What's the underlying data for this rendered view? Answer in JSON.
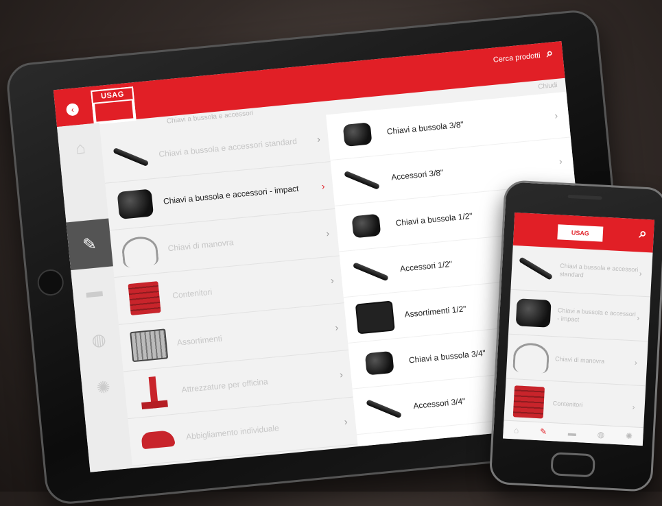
{
  "tablet": {
    "header": {
      "logo_text": "USAG",
      "search_label": "Cerca prodotti",
      "search_icon": "search-icon",
      "back_icon": "back-icon"
    },
    "breadcrumb": "Chiavi a bussola e accessori",
    "close_label": "Chiudi",
    "rail": [
      {
        "icon": "home-icon"
      },
      {
        "icon": "wrench-icon",
        "active": true
      },
      {
        "icon": "car-icon"
      },
      {
        "icon": "globe-icon"
      },
      {
        "icon": "settings-icon"
      }
    ],
    "categories": [
      {
        "label": "Chiavi a bussola e accessori standard",
        "image": "ratchet-image"
      },
      {
        "label": "Chiavi a bussola e accessori - impact",
        "image": "impact-socket-image",
        "selected": true
      },
      {
        "label": "Chiavi di manovra",
        "image": "pliers-image"
      },
      {
        "label": "Contenitori",
        "image": "tool-cabinet-image"
      },
      {
        "label": "Assortimenti",
        "image": "tool-case-image"
      },
      {
        "label": "Attrezzature per officina",
        "image": "jack-image"
      },
      {
        "label": "Abbigliamento individuale",
        "image": "safety-shoe-image"
      }
    ],
    "subcategories": [
      {
        "label": "Chiavi a bussola 3/8\"",
        "image": "socket-image"
      },
      {
        "label": "Accessori 3/8\"",
        "image": "extension-bar-image"
      },
      {
        "label": "Chiavi a bussola 1/2\"",
        "image": "socket-image"
      },
      {
        "label": "Accessori 1/2\"",
        "image": "extension-bar-image"
      },
      {
        "label": "Assortimenti 1/2\"",
        "image": "socket-case-image"
      },
      {
        "label": "Chiavi a bussola 3/4\"",
        "image": "socket-image"
      },
      {
        "label": "Accessori 3/4\"",
        "image": "extension-bar-image"
      }
    ]
  },
  "phone": {
    "logo_text": "USAG",
    "search_icon": "search-icon",
    "categories": [
      {
        "label": "Chiavi a bussola e accessori standard"
      },
      {
        "label": "Chiavi a bussola e accessori - impact"
      },
      {
        "label": "Chiavi di manovra"
      },
      {
        "label": "Contenitori"
      }
    ],
    "nav": [
      {
        "icon": "home-icon"
      },
      {
        "icon": "wrench-icon",
        "active": true
      },
      {
        "icon": "car-icon"
      },
      {
        "icon": "globe-icon"
      },
      {
        "icon": "settings-icon"
      }
    ]
  },
  "colors": {
    "brand_red": "#e11f26",
    "rail_active": "#545454",
    "background": "#332b28"
  }
}
